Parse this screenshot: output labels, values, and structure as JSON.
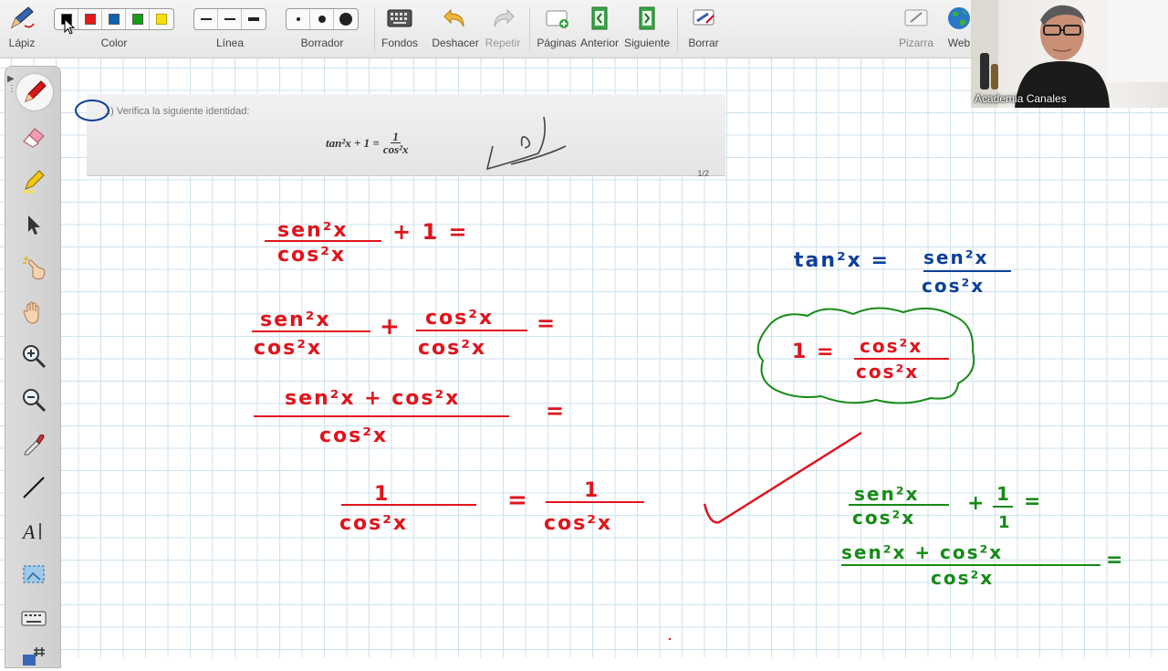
{
  "toolbar": {
    "pencil_label": "Lápiz",
    "color_label": "Color",
    "line_label": "Línea",
    "eraser_label": "Borrador",
    "backgrounds_label": "Fondos",
    "undo_label": "Deshacer",
    "redo_label": "Repetir",
    "pages_label": "Páginas",
    "previous_label": "Anterior",
    "next_label": "Siguiente",
    "clear_label": "Borrar",
    "whiteboard_label": "Pizarra",
    "web_label": "Web",
    "colors": [
      "#000000",
      "#e81818",
      "#1060b0",
      "#13a013",
      "#f6e00c"
    ]
  },
  "problem": {
    "statement": "1) Verifica la siguiente identidad:",
    "formula_left": "tan²x + 1 =",
    "formula_num": "1",
    "formula_den": "cos²x",
    "page_marker": "1/2"
  },
  "board": {
    "step1_num": "sen²x",
    "step1_den": "cos²x",
    "step1_rest": "+ 1 =",
    "step2_num_a": "sen²x",
    "step2_den_a": "cos²x",
    "step2_plus": "+",
    "step2_num_b": "cos²x",
    "step2_den_b": "cos²x",
    "step2_eq": "=",
    "step3_num": "sen²x + cos²x",
    "step3_den": "cos²x",
    "step3_eq": "=",
    "step4_num_a": "1",
    "step4_den_a": "cos²x",
    "step4_eq": "=",
    "step4_num_b": "1",
    "step4_den_b": "cos²x",
    "tan_lhs": "tan²x =",
    "tan_num": "sen²x",
    "tan_den": "cos²x",
    "one_lhs": "1 =",
    "one_num": "cos²x",
    "one_den": "cos²x",
    "g1_num": "sen²x",
    "g1_den": "cos²x",
    "g1_plus": "+",
    "g1_num2": "1",
    "g1_den2": "1",
    "g1_eq": "=",
    "g2_num": "sen²x + cos²x",
    "g2_den": "cos²x",
    "g2_eq": "="
  },
  "webcam": {
    "name": "Academia Canales"
  },
  "ink_colors": {
    "red": "#e0141c",
    "blue": "#0d3f9a",
    "green": "#168a16"
  }
}
